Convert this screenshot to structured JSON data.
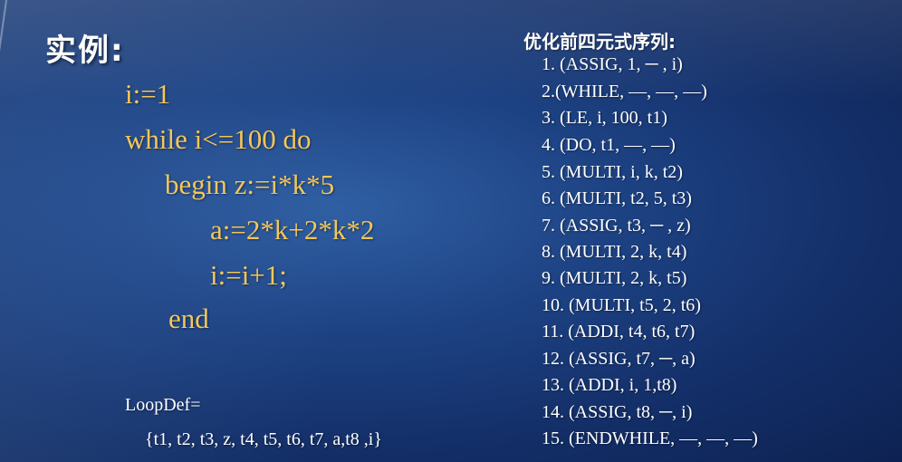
{
  "slide": {
    "title": "实例:"
  },
  "code": {
    "lines": [
      "i:=1",
      "while i<=100 do",
      "begin z:=i*k*5",
      "a:=2*k+2*k*2",
      "i:=i+1;",
      "end"
    ]
  },
  "loopdef": {
    "label": "LoopDef=",
    "set": "{t1, t2, t3, z, t4, t5, t6, t7, a,t8 ,i}"
  },
  "quads": {
    "heading": "优化前四元式序列:",
    "items": [
      "1. (ASSIG, 1, ─ , i)",
      "2.(WHILE, —,  —,  —)",
      "3. (LE, i, 100, t1)",
      "4. (DO, t1, —,   —)",
      "5. (MULTI, i, k, t2)",
      "6. (MULTI, t2, 5, t3)",
      "7. (ASSIG, t3, ─ , z)",
      "8. (MULTI, 2, k, t4)",
      "9. (MULTI, 2, k, t5)",
      "10. (MULTI, t5, 2, t6)",
      "11.  (ADDI, t4, t6, t7)",
      "12.  (ASSIG, t7, ─, a)",
      "13.  (ADDI, i, 1,t8)",
      "14.  (ASSIG, t8, ─, i)",
      "15.  (ENDWHILE, —,  —,  —)"
    ]
  }
}
